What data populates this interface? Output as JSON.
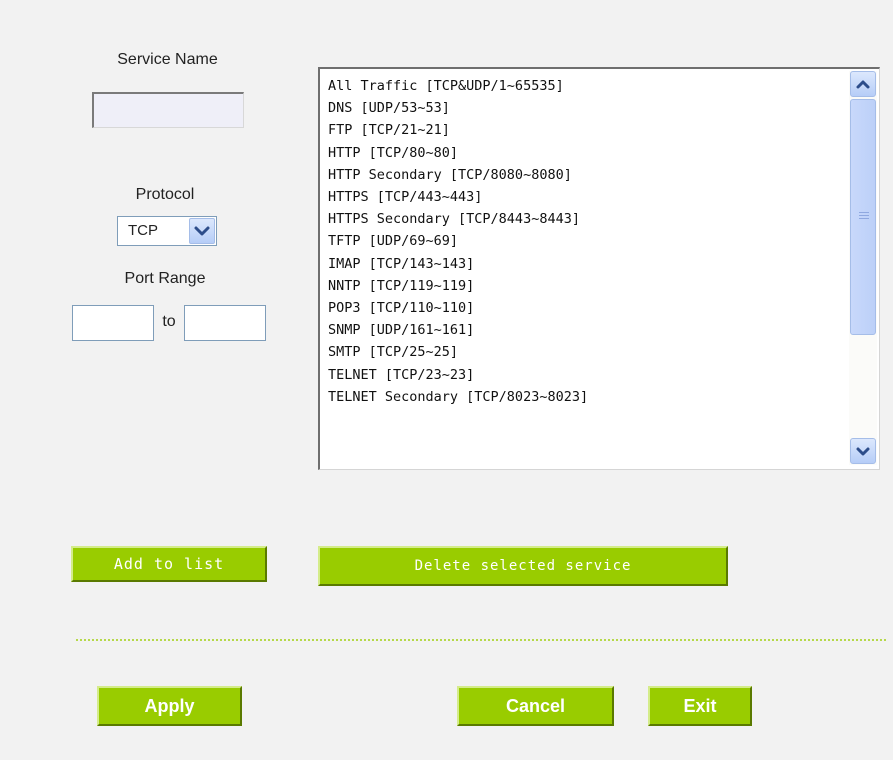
{
  "form": {
    "service_name_label": "Service Name",
    "service_name_value": "",
    "protocol_label": "Protocol",
    "protocol_value": "TCP",
    "port_range_label": "Port Range",
    "port_from_value": "",
    "port_to_label": "to",
    "port_to_value": ""
  },
  "services": [
    "All Traffic [TCP&UDP/1~65535]",
    "DNS [UDP/53~53]",
    "FTP [TCP/21~21]",
    "HTTP [TCP/80~80]",
    "HTTP Secondary [TCP/8080~8080]",
    "HTTPS [TCP/443~443]",
    "HTTPS Secondary [TCP/8443~8443]",
    "TFTP [UDP/69~69]",
    "IMAP [TCP/143~143]",
    "NNTP [TCP/119~119]",
    "POP3 [TCP/110~110]",
    "SNMP [UDP/161~161]",
    "SMTP [TCP/25~25]",
    "TELNET [TCP/23~23]",
    "TELNET Secondary [TCP/8023~8023]"
  ],
  "buttons": {
    "add_to_list": "Add to list",
    "delete_selected": "Delete selected service",
    "apply": "Apply",
    "cancel": "Cancel",
    "exit": "Exit"
  },
  "icons": {
    "dropdown": "chevron-down-icon",
    "scroll_up": "chevron-up-icon",
    "scroll_down": "chevron-down-icon",
    "scroll_grip": "grip-icon"
  },
  "colors": {
    "button_green": "#99cc00",
    "divider": "#b6d94a",
    "page_background": "#f2f2f2"
  }
}
